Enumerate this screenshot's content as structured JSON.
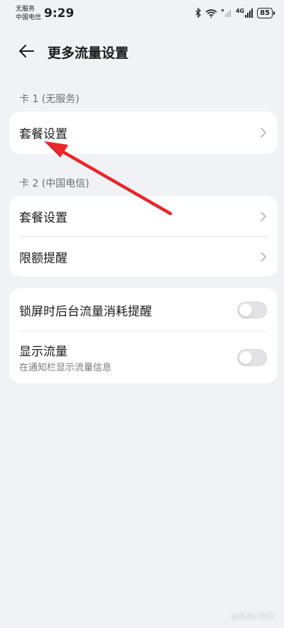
{
  "status_bar": {
    "carrier_line1": "无服务",
    "carrier_line2": "中国电信",
    "time": "9:29",
    "signal_badge": "4G",
    "battery": "85",
    "icons": [
      "bluetooth-icon",
      "wifi-icon",
      "signal-off-icon",
      "signal-4g-icon",
      "battery-icon"
    ]
  },
  "header": {
    "title": "更多流量设置",
    "back_icon": "back-arrow-icon"
  },
  "sections": {
    "card1": {
      "label": "卡 1 (无服务)",
      "items": [
        {
          "label": "套餐设置"
        }
      ]
    },
    "card2": {
      "label": "卡 2 (中国电信)",
      "items": [
        {
          "label": "套餐设置"
        },
        {
          "label": "限额提醒"
        }
      ]
    },
    "toggles": {
      "items": [
        {
          "label": "锁屏时后台流量消耗提醒",
          "on": false
        },
        {
          "label": "显示流量",
          "sublabel": "在通知栏显示流量信息",
          "on": false
        }
      ]
    }
  },
  "annotation": {
    "color": "#e8262b"
  },
  "watermark": "@互动小精丰"
}
